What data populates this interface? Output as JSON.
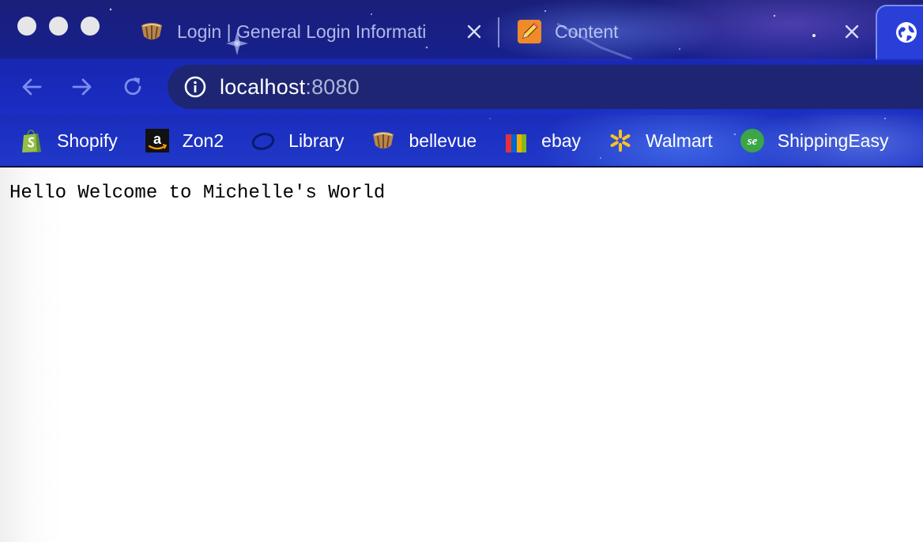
{
  "browser": {
    "tabs": [
      {
        "title": "Login | General Login Informati",
        "favicon": "bellevue-crest-icon",
        "active": false
      },
      {
        "title": "Content",
        "favicon": "pencil-icon",
        "active": false
      },
      {
        "title": "",
        "favicon": "globe-icon",
        "active": true
      }
    ],
    "address_bar": {
      "host": "localhost",
      "port": ":8080",
      "icon": "info-icon"
    },
    "bookmarks": [
      {
        "label": "Shopify",
        "icon": "shopify-bag-icon"
      },
      {
        "label": "Zon2",
        "icon": "amazon-icon"
      },
      {
        "label": "Library",
        "icon": "library-ring-icon"
      },
      {
        "label": "bellevue",
        "icon": "bellevue-crest-icon"
      },
      {
        "label": "ebay",
        "icon": "ebay-bag-icon"
      },
      {
        "label": "Walmart",
        "icon": "walmart-spark-icon"
      },
      {
        "label": "ShippingEasy",
        "icon": "shippingeasy-icon"
      }
    ],
    "theme_colors": {
      "toolbar": "#1c30d2",
      "omnibox": "#1e2673",
      "text": "#ffffff"
    }
  },
  "page": {
    "text": "Hello Welcome to Michelle's World"
  }
}
